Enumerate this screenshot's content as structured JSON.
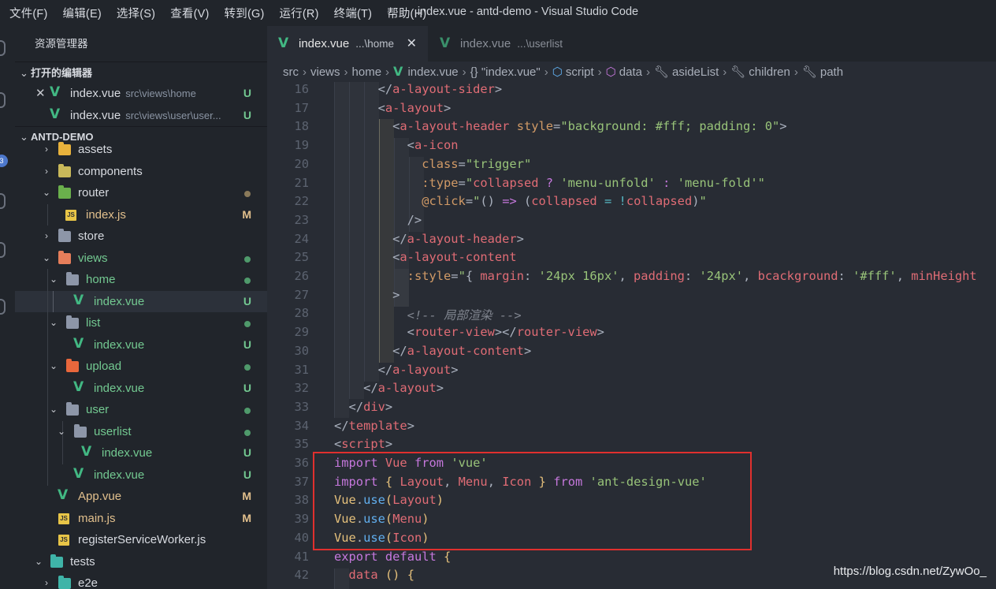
{
  "menu": [
    "文件(F)",
    "编辑(E)",
    "选择(S)",
    "查看(V)",
    "转到(G)",
    "运行(R)",
    "终端(T)",
    "帮助(H)"
  ],
  "window_title": "index.vue - antd-demo - Visual Studio Code",
  "activity_badge": "3",
  "sidebar": {
    "title": "资源管理器",
    "open_editors_label": "打开的编辑器",
    "open_editors": [
      {
        "name": "index.vue",
        "path": "src\\views\\home",
        "status": "U"
      },
      {
        "name": "index.vue",
        "path": "src\\views\\user\\user...",
        "status": "U"
      }
    ],
    "project_label": "ANTD-DEMO",
    "tree": [
      {
        "name": "assets",
        "status": ""
      },
      {
        "name": "components",
        "status": ""
      },
      {
        "name": "router",
        "status": ""
      },
      {
        "name": "index.js",
        "status": "M"
      },
      {
        "name": "store",
        "status": ""
      },
      {
        "name": "views",
        "status": ""
      },
      {
        "name": "home",
        "status": ""
      },
      {
        "name": "index.vue",
        "status": "U"
      },
      {
        "name": "list",
        "status": ""
      },
      {
        "name": "index.vue",
        "status": "U"
      },
      {
        "name": "upload",
        "status": ""
      },
      {
        "name": "index.vue",
        "status": "U"
      },
      {
        "name": "user",
        "status": ""
      },
      {
        "name": "userlist",
        "status": ""
      },
      {
        "name": "index.vue",
        "status": "U"
      },
      {
        "name": "index.vue",
        "status": "U"
      },
      {
        "name": "App.vue",
        "status": "M"
      },
      {
        "name": "main.js",
        "status": "M"
      },
      {
        "name": "registerServiceWorker.js",
        "status": ""
      },
      {
        "name": "tests",
        "status": ""
      },
      {
        "name": "e2e",
        "status": ""
      }
    ]
  },
  "tabs": [
    {
      "name": "index.vue",
      "path": "...\\home"
    },
    {
      "name": "index.vue",
      "path": "...\\userlist"
    }
  ],
  "breadcrumb": [
    "src",
    "views",
    "home",
    "index.vue",
    "{} \"index.vue\"",
    "script",
    "data",
    "asideList",
    "children",
    "path"
  ],
  "editor": {
    "line_numbers": [
      "16",
      "17",
      "18",
      "19",
      "20",
      "21",
      "22",
      "23",
      "24",
      "25",
      "26",
      "27",
      "28",
      "29",
      "30",
      "31",
      "32",
      "33",
      "34",
      "35",
      "36",
      "37",
      "38",
      "39",
      "40",
      "41",
      "42"
    ]
  },
  "colors": {
    "vue_green": "#42b883",
    "untracked": "#73c991",
    "modified": "#e2c08d",
    "highlight_box": "#e0302e"
  },
  "watermark": "https://blog.csdn.net/ZywOo_"
}
